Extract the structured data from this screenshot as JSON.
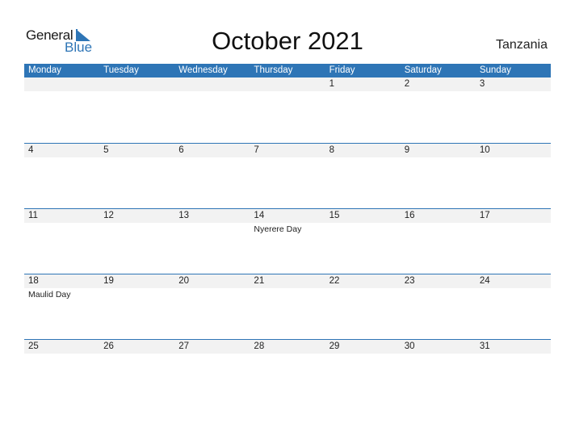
{
  "logo": {
    "general": "General",
    "blue": "Blue"
  },
  "title": "October 2021",
  "country": "Tanzania",
  "weekdays": [
    "Monday",
    "Tuesday",
    "Wednesday",
    "Thursday",
    "Friday",
    "Saturday",
    "Sunday"
  ],
  "weeks": [
    {
      "days": [
        "",
        "",
        "",
        "",
        "1",
        "2",
        "3"
      ],
      "holidays": [
        "",
        "",
        "",
        "",
        "",
        "",
        ""
      ]
    },
    {
      "days": [
        "4",
        "5",
        "6",
        "7",
        "8",
        "9",
        "10"
      ],
      "holidays": [
        "",
        "",
        "",
        "",
        "",
        "",
        ""
      ]
    },
    {
      "days": [
        "11",
        "12",
        "13",
        "14",
        "15",
        "16",
        "17"
      ],
      "holidays": [
        "",
        "",
        "",
        "Nyerere Day",
        "",
        "",
        ""
      ]
    },
    {
      "days": [
        "18",
        "19",
        "20",
        "21",
        "22",
        "23",
        "24"
      ],
      "holidays": [
        "Maulid Day",
        "",
        "",
        "",
        "",
        "",
        ""
      ]
    },
    {
      "days": [
        "25",
        "26",
        "27",
        "28",
        "29",
        "30",
        "31"
      ],
      "holidays": [
        "",
        "",
        "",
        "",
        "",
        "",
        ""
      ]
    }
  ],
  "colors": {
    "accent": "#2e75b6",
    "date_row": "#f2f2f2"
  }
}
